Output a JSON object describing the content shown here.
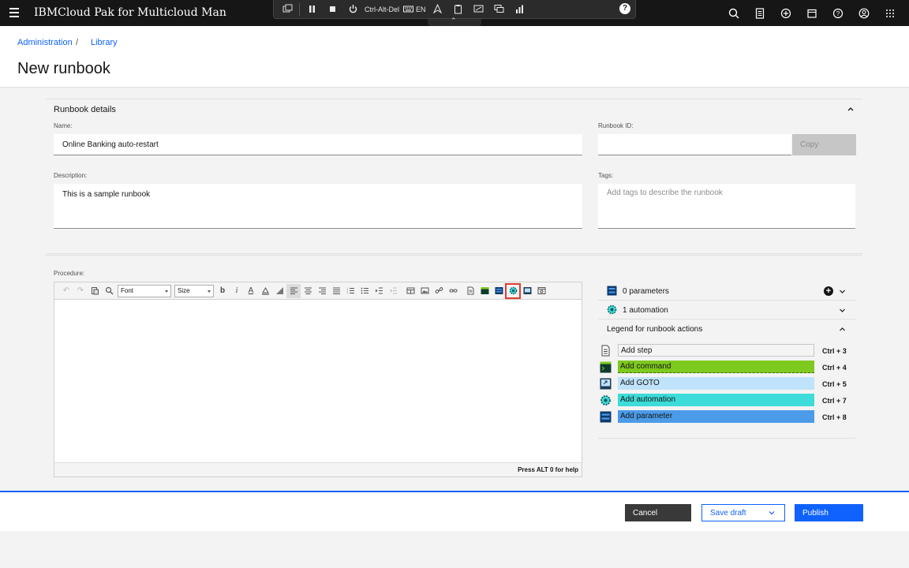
{
  "topbar": {
    "brand": "IBMCloud Pak for Multicloud Management",
    "icons": [
      "search-icon",
      "notes-icon",
      "add-icon",
      "calendar-icon",
      "help-icon",
      "user-icon",
      "app-switcher-icon"
    ]
  },
  "rdbar": {
    "ctrl_alt_del": "Ctrl-Alt-Del",
    "lang": "EN",
    "help": "?"
  },
  "breadcrumb": {
    "item1": "Administration",
    "sep": "/",
    "item2": "Library"
  },
  "page_title": "New runbook",
  "details": {
    "title": "Runbook details",
    "name_label": "Name:",
    "name_value": "Online Banking auto-restart",
    "id_label": "Runbook ID:",
    "id_value": "",
    "copy_label": "Copy",
    "desc_label": "Description:",
    "desc_value": "This is a sample runbook",
    "tags_label": "Tags:",
    "tags_placeholder": "Add tags to describe the runbook"
  },
  "procedure": {
    "label": "Procedure:",
    "font_select": "Font",
    "size_select": "Size",
    "help_text": "Press ALT 0 for help"
  },
  "right_panel": {
    "parameters": "0 parameters",
    "automation": "1 automation",
    "legend_title": "Legend for runbook actions",
    "legend": [
      {
        "label": "Add step",
        "key": "Ctrl + 3",
        "color": "#f4f4f4"
      },
      {
        "label": "Add  command",
        "key": "Ctrl + 4",
        "color": "#7ec91e"
      },
      {
        "label": "Add GOTO",
        "key": "Ctrl + 5",
        "color": "#bfe3fb"
      },
      {
        "label": "Add automation",
        "key": "Ctrl + 7",
        "color": "#3ddbd9"
      },
      {
        "label": "Add parameter",
        "key": "Ctrl + 8",
        "color": "#4b9be8"
      }
    ]
  },
  "footer": {
    "cancel": "Cancel",
    "save_draft": "Save draft",
    "publish": "Publish"
  },
  "colors": {
    "primary": "#0f62fe",
    "topbar": "#161616",
    "highlight": "#e03c31"
  }
}
